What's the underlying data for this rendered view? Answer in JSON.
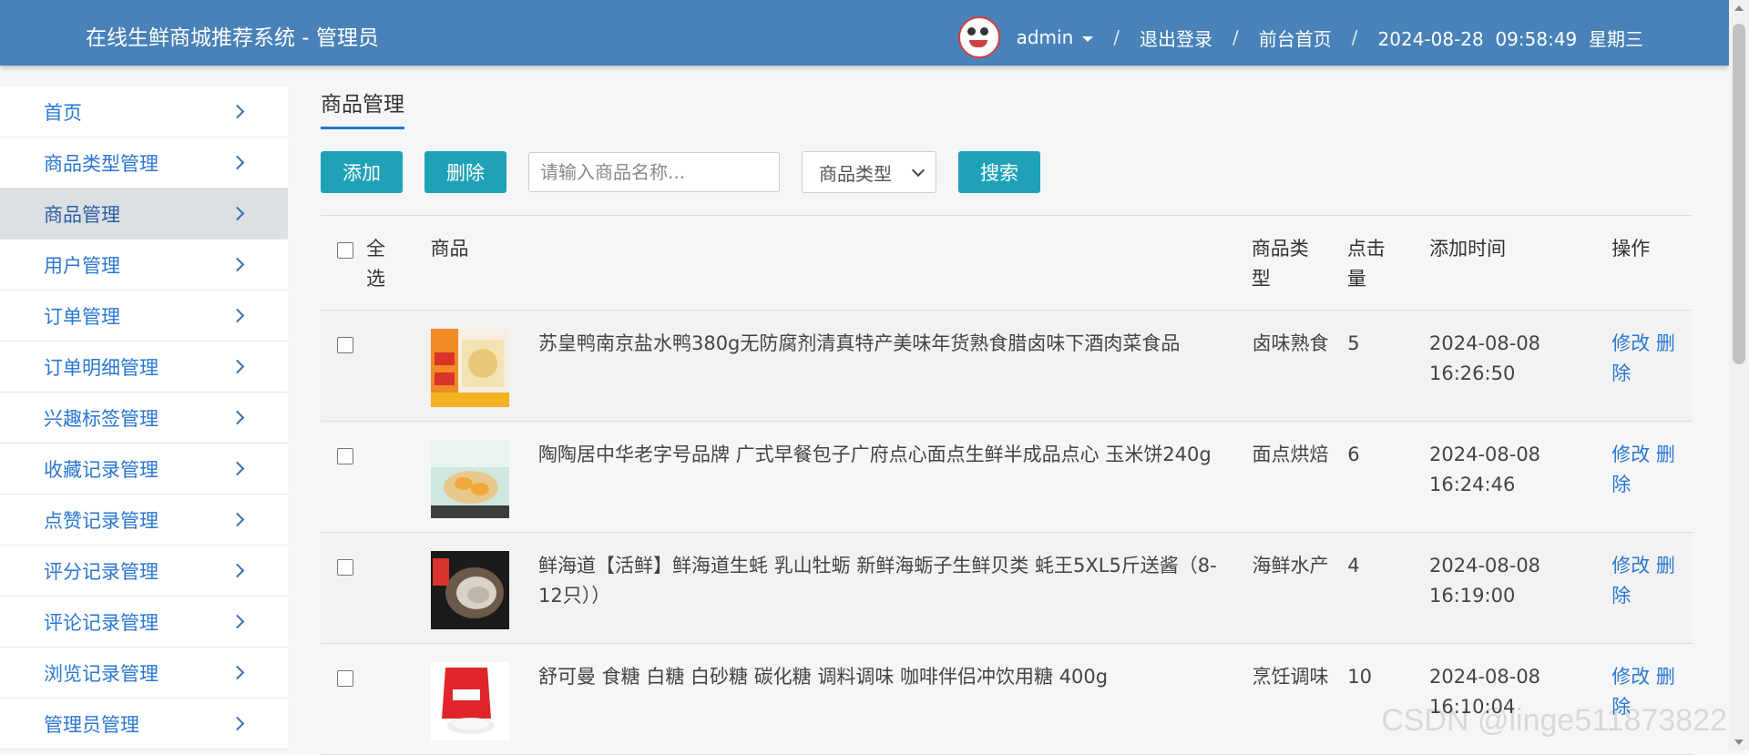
{
  "header": {
    "title": "在线生鲜商城推荐系统 - 管理员",
    "user": "admin",
    "logout": "退出登录",
    "home": "前台首页",
    "sep": "/",
    "datetime": "2024-08-28  09:58:49  星期三"
  },
  "sidebar": {
    "items": [
      {
        "label": "首页"
      },
      {
        "label": "商品类型管理"
      },
      {
        "label": "商品管理"
      },
      {
        "label": "用户管理"
      },
      {
        "label": "订单管理"
      },
      {
        "label": "订单明细管理"
      },
      {
        "label": "兴趣标签管理"
      },
      {
        "label": "收藏记录管理"
      },
      {
        "label": "点赞记录管理"
      },
      {
        "label": "评分记录管理"
      },
      {
        "label": "评论记录管理"
      },
      {
        "label": "浏览记录管理"
      },
      {
        "label": "管理员管理"
      }
    ]
  },
  "main": {
    "title": "商品管理",
    "toolbar": {
      "add": "添加",
      "delete": "删除",
      "search_placeholder": "请输入商品名称...",
      "type_select": "商品类型",
      "search": "搜索"
    },
    "table": {
      "headers": {
        "select_all": "全选",
        "product": "商品",
        "type": "商品类型",
        "clicks": "点击量",
        "time": "添加时间",
        "ops": "操作"
      },
      "rows": [
        {
          "name": "苏皇鸭南京盐水鸭380g无防腐剂清真特产美味年货熟食腊卤味下酒肉菜食品",
          "type": "卤味熟食",
          "clicks": "5",
          "date": "2024-08-08",
          "time": "16:26:50"
        },
        {
          "name": "陶陶居中华老字号品牌 广式早餐包子广府点心面点生鲜半成品点心 玉米饼240g",
          "type": "面点烘焙",
          "clicks": "6",
          "date": "2024-08-08",
          "time": "16:24:46"
        },
        {
          "name": "鲜海道【活鲜】鲜海道生蚝 乳山牡蛎 新鲜海蛎子生鲜贝类 蚝王5XL5斤送酱（8-12只））",
          "type": "海鲜水产",
          "clicks": "4",
          "date": "2024-08-08",
          "time": "16:19:00"
        },
        {
          "name": "舒可曼 食糖 白糖 白砂糖 碳化糖 调料调味 咖啡伴侣冲饮用糖 400g",
          "type": "烹饪调味",
          "clicks": "10",
          "date": "2024-08-08",
          "time": "16:10:04"
        }
      ],
      "edit": "修改",
      "remove": "删除"
    }
  },
  "watermark": "CSDN @linge511873822"
}
